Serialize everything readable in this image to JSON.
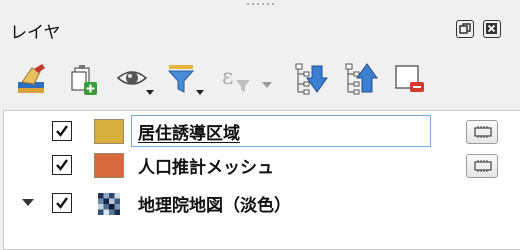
{
  "panel": {
    "title": "レイヤ"
  },
  "toolbar": {
    "buttons": [
      {
        "name": "open-layer-styling-icon"
      },
      {
        "name": "add-group-icon"
      },
      {
        "name": "manage-map-themes-icon"
      },
      {
        "name": "filter-legend-icon"
      },
      {
        "name": "filter-by-expression-icon"
      },
      {
        "name": "expand-all-icon"
      },
      {
        "name": "collapse-all-icon"
      },
      {
        "name": "remove-layer-icon"
      }
    ]
  },
  "layers": [
    {
      "name": "居住誘導区域",
      "checked": true,
      "swatch_color": "#d8ae3c",
      "selected": true
    },
    {
      "name": "人口推計メッシュ",
      "checked": true,
      "swatch_color": "#d7693e",
      "selected": false
    },
    {
      "name": "地理院地図（淡色）",
      "checked": true,
      "type": "raster",
      "expanded": true
    }
  ],
  "colors": {
    "selection_border": "#7aa7d9",
    "panel_bg": "#f0f0f0"
  }
}
